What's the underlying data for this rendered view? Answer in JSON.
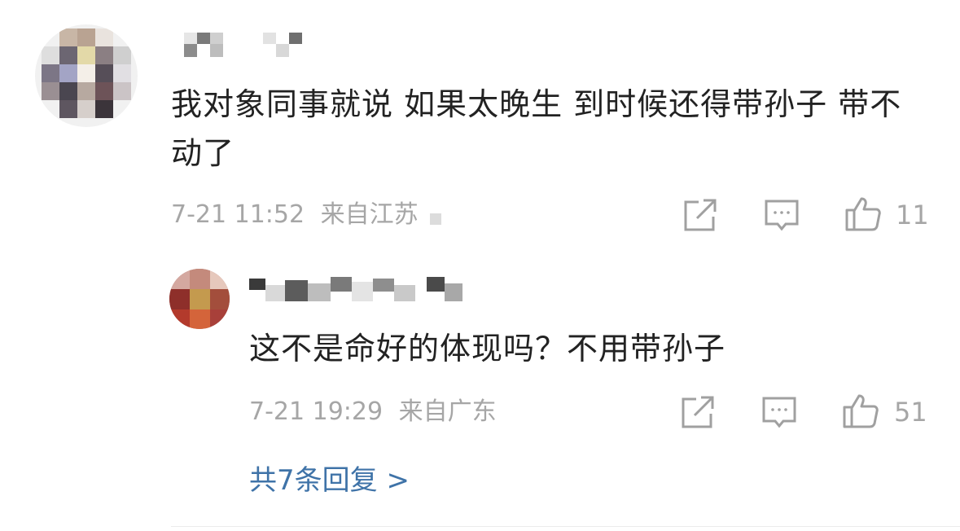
{
  "comment": {
    "text": "我对象同事就说 如果太晚生 到时候还得带孙子 带不动了",
    "date": "7-21 11:52",
    "location": "来自江苏",
    "likes": "11",
    "icons": {
      "share": "share-icon",
      "reply": "comment-icon",
      "like": "thumbs-up-icon"
    }
  },
  "reply": {
    "text": "这不是命好的体现吗？不用带孙子",
    "date": "7-21 19:29",
    "location": "来自广东",
    "likes": "51",
    "icons": {
      "share": "share-icon",
      "reply": "comment-icon",
      "like": "thumbs-up-icon"
    }
  },
  "more_replies": "共7条回复 >",
  "colors": {
    "text": "#222222",
    "meta": "#a6a6a6",
    "link": "#3f73a8"
  }
}
